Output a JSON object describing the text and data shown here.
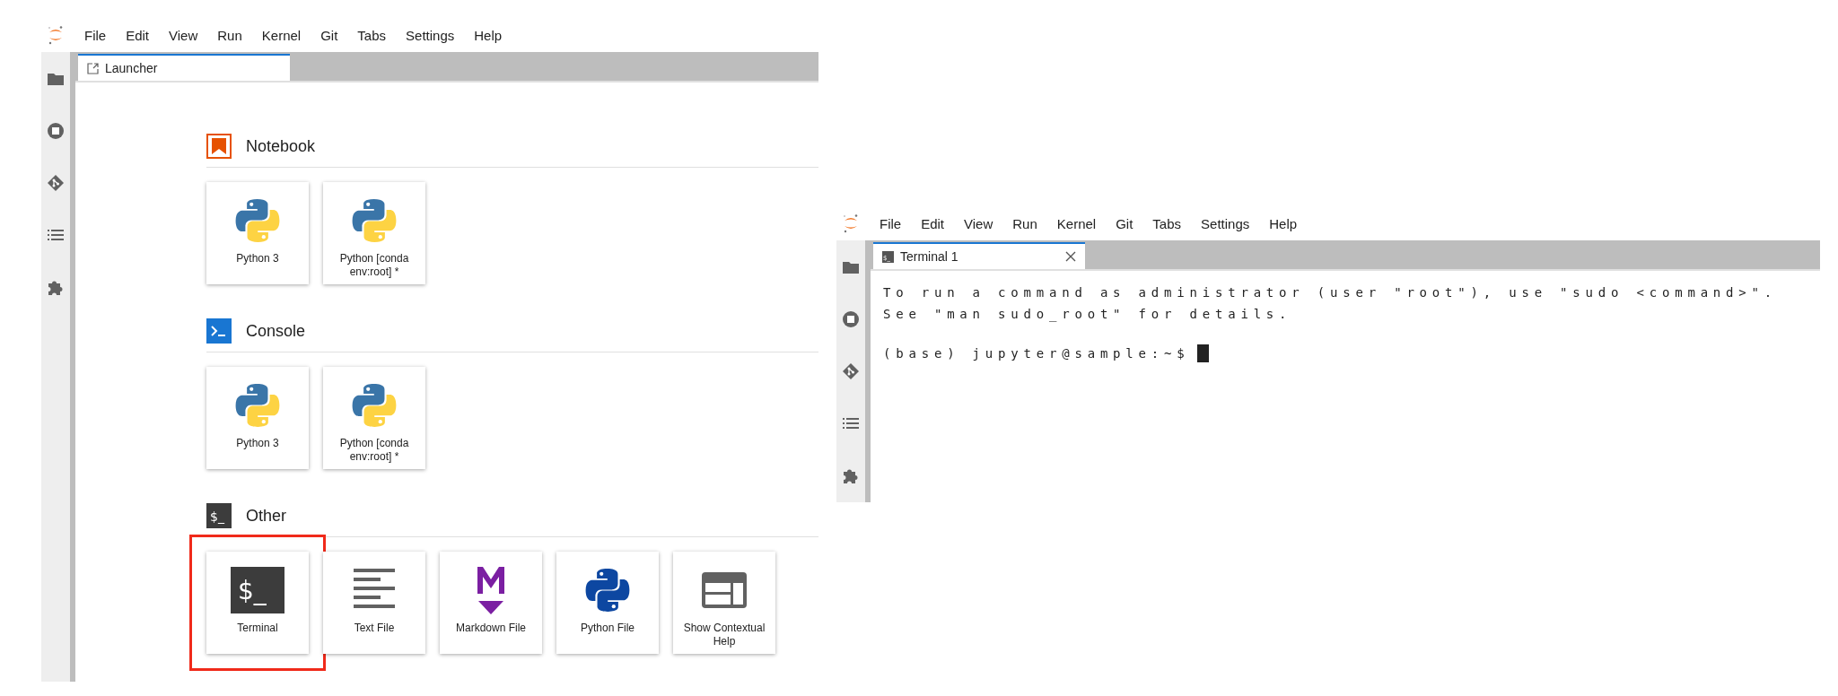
{
  "launcher_window": {
    "menu": [
      "File",
      "Edit",
      "View",
      "Run",
      "Kernel",
      "Git",
      "Tabs",
      "Settings",
      "Help"
    ],
    "tabs": [
      {
        "label": "Launcher",
        "selected": true,
        "kind": "launcher"
      }
    ],
    "sections": [
      {
        "title": "Notebook",
        "kind": "notebook",
        "items": [
          {
            "label": "Python 3",
            "kind": "python-kernel",
            "highlighted": false
          },
          {
            "label": "Python [conda env:root] *",
            "kind": "python-kernel",
            "highlighted": false
          }
        ]
      },
      {
        "title": "Console",
        "kind": "console",
        "items": [
          {
            "label": "Python 3",
            "kind": "python-kernel",
            "highlighted": false
          },
          {
            "label": "Python [conda env:root] *",
            "kind": "python-kernel",
            "highlighted": false
          }
        ]
      },
      {
        "title": "Other",
        "kind": "other",
        "icon_text": "$_",
        "items": [
          {
            "label": "Terminal",
            "kind": "terminal",
            "icon_text": "$_",
            "highlighted": true
          },
          {
            "label": "Text File",
            "kind": "text",
            "highlighted": false
          },
          {
            "label": "Markdown File",
            "kind": "markdown",
            "highlighted": false
          },
          {
            "label": "Python File",
            "kind": "python-file",
            "highlighted": false
          },
          {
            "label": "Show Contextual Help",
            "kind": "help",
            "highlighted": false
          }
        ]
      }
    ]
  },
  "terminal_window": {
    "menu": [
      "File",
      "Edit",
      "View",
      "Run",
      "Kernel",
      "Git",
      "Tabs",
      "Settings",
      "Help"
    ],
    "tabs": [
      {
        "label": "Terminal 1",
        "selected": true,
        "kind": "terminal",
        "icon_text": "$_"
      }
    ],
    "lines": [
      "To run a command as administrator (user \"root\"), use \"sudo <command>\".",
      "See \"man sudo_root\" for details."
    ],
    "prompt": "(base) jupyter@sample:~$",
    "cursor": true
  }
}
